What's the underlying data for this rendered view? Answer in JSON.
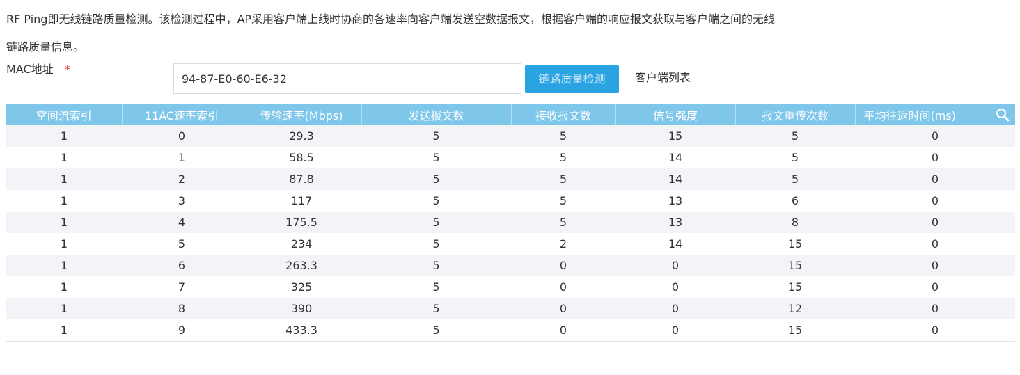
{
  "description": {
    "line1": "RF Ping即无线链路质量检测。该检测过程中，AP采用客户端上线时协商的各速率向客户端发送空数据报文，根据客户端的响应报文获取与客户端之间的无线",
    "line2": "链路质量信息。"
  },
  "form": {
    "mac_label": "MAC地址",
    "required_mark": "*",
    "mac_value": "94-87-E0-60-E6-32",
    "check_button": "链路质量检测",
    "client_list_link": "客户端列表"
  },
  "table": {
    "header_color": "#7ec6ea",
    "columns": [
      "空间流索引",
      "11AC速率索引",
      "传输速率(Mbps)",
      "发送报文数",
      "接收报文数",
      "信号强度",
      "报文重传次数",
      "平均往返时间(ms)"
    ],
    "search_icon": "search-icon",
    "rows": [
      [
        "1",
        "0",
        "29.3",
        "5",
        "5",
        "15",
        "5",
        "0"
      ],
      [
        "1",
        "1",
        "58.5",
        "5",
        "5",
        "14",
        "5",
        "0"
      ],
      [
        "1",
        "2",
        "87.8",
        "5",
        "5",
        "14",
        "5",
        "0"
      ],
      [
        "1",
        "3",
        "117",
        "5",
        "5",
        "13",
        "6",
        "0"
      ],
      [
        "1",
        "4",
        "175.5",
        "5",
        "5",
        "13",
        "8",
        "0"
      ],
      [
        "1",
        "5",
        "234",
        "5",
        "2",
        "14",
        "15",
        "0"
      ],
      [
        "1",
        "6",
        "263.3",
        "5",
        "0",
        "0",
        "15",
        "0"
      ],
      [
        "1",
        "7",
        "325",
        "5",
        "0",
        "0",
        "15",
        "0"
      ],
      [
        "1",
        "8",
        "390",
        "5",
        "0",
        "0",
        "12",
        "0"
      ],
      [
        "1",
        "9",
        "433.3",
        "5",
        "0",
        "0",
        "15",
        "0"
      ]
    ]
  }
}
